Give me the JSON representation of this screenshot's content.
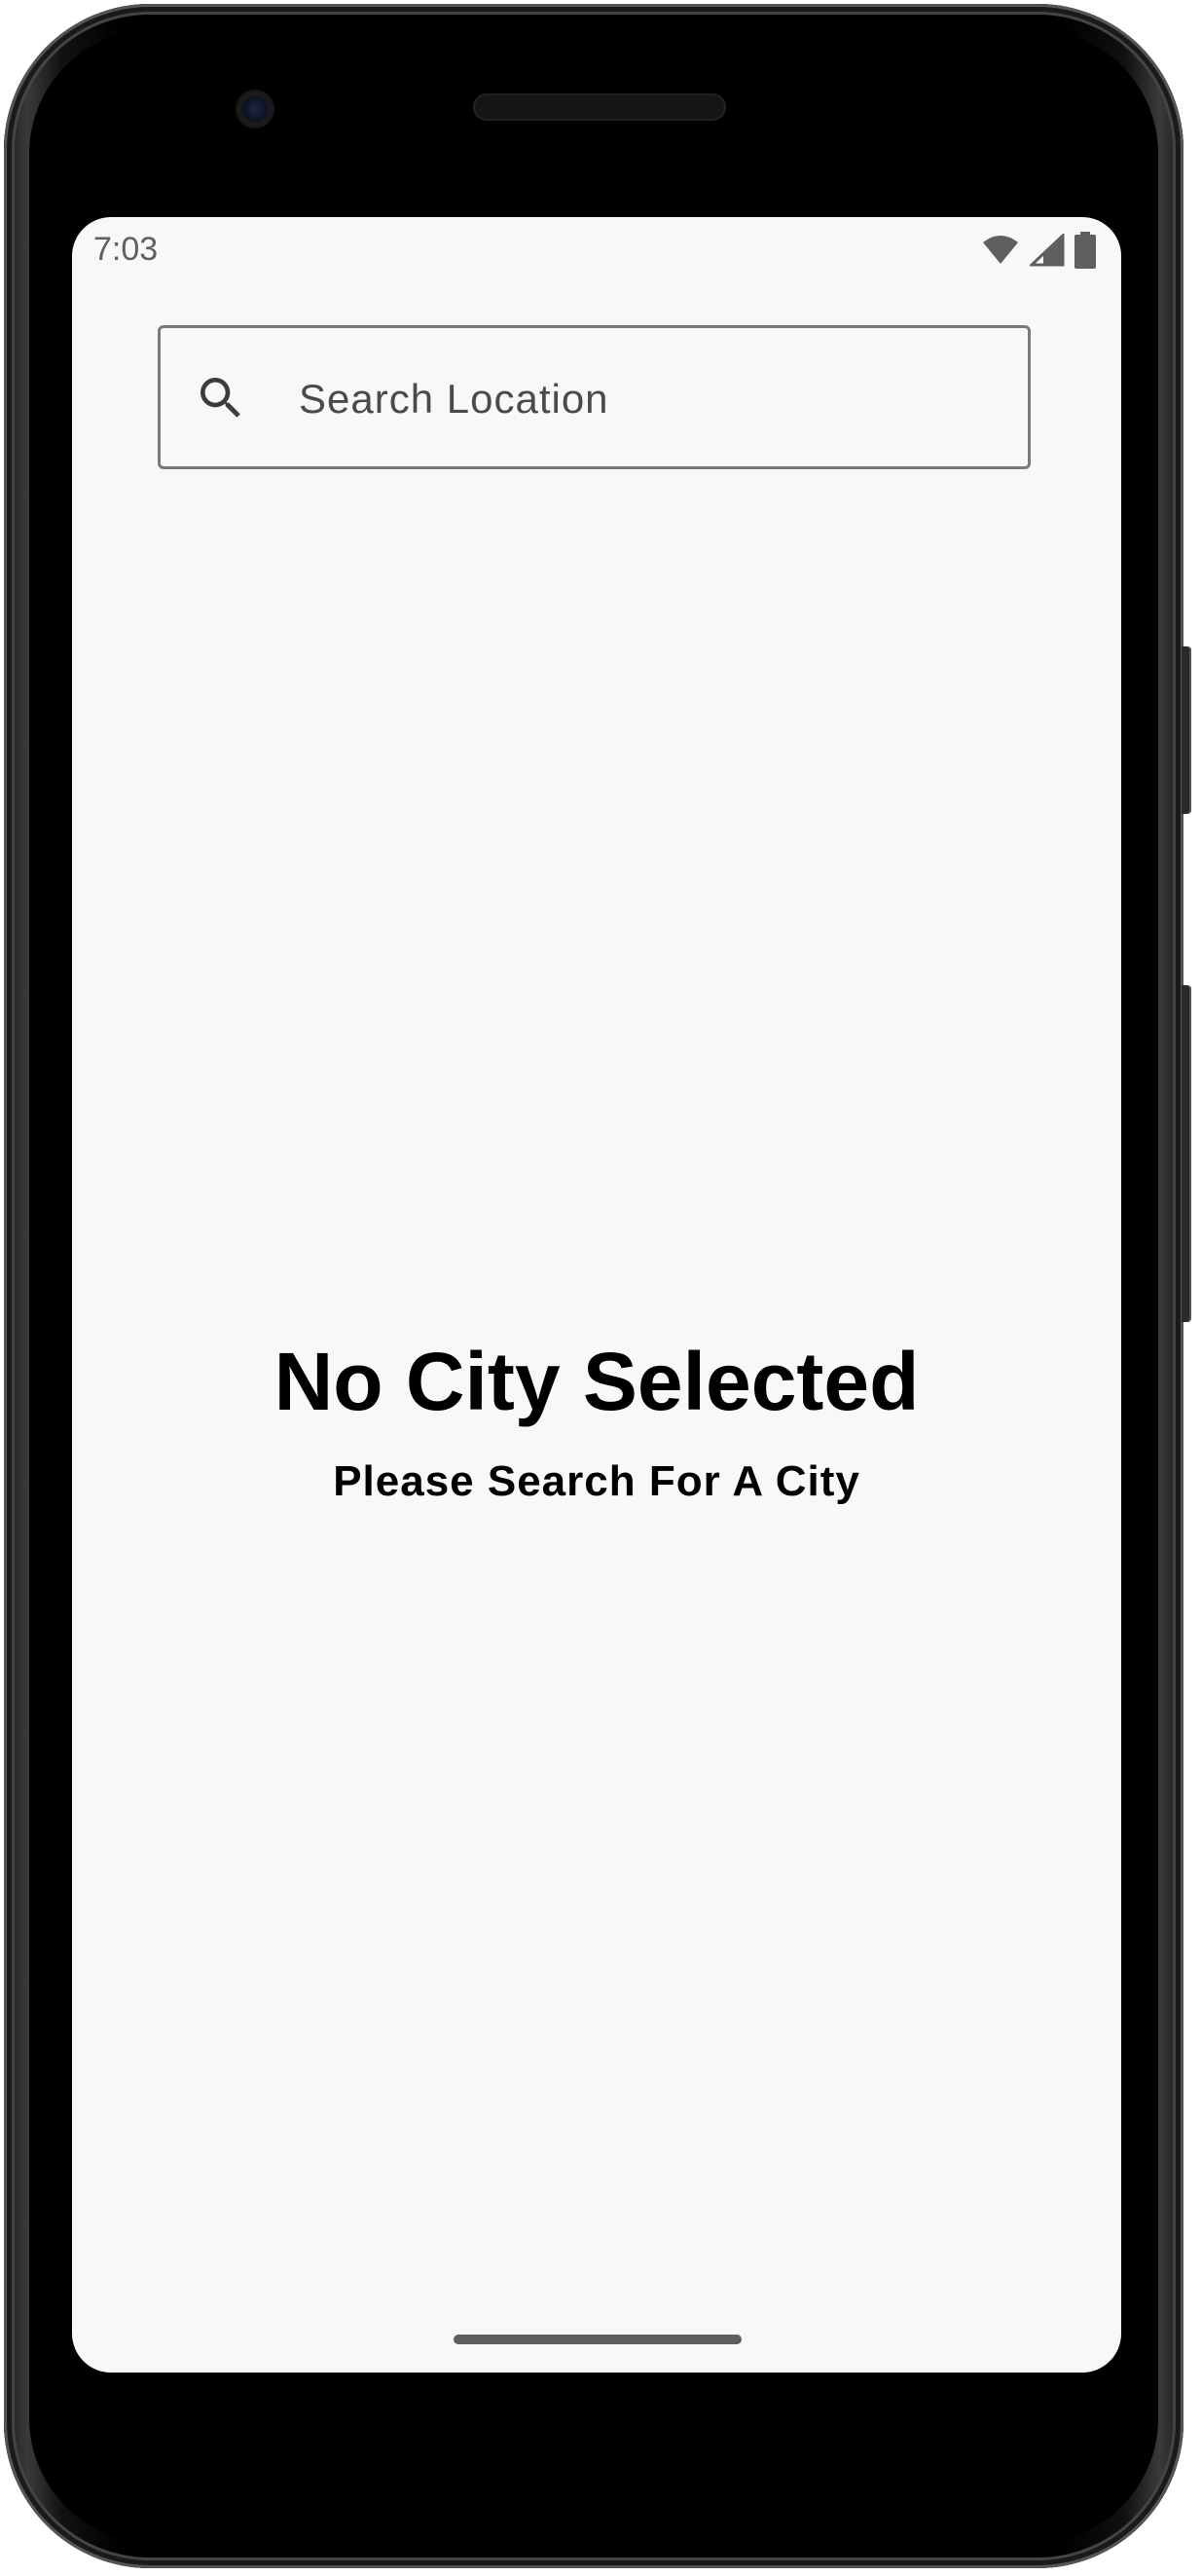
{
  "status_bar": {
    "time": "7:03",
    "icons": [
      "wifi-icon",
      "cellular-signal-icon",
      "battery-icon"
    ]
  },
  "search": {
    "placeholder": "Search Location",
    "value": "",
    "icon": "search-icon"
  },
  "empty_state": {
    "title": "No City Selected",
    "subtitle": "Please Search For A City"
  },
  "colors": {
    "screen_background": "#f8f8f8",
    "text_primary": "#000000",
    "text_secondary": "#4a4a4a",
    "status_icon": "#5f5f5f"
  }
}
